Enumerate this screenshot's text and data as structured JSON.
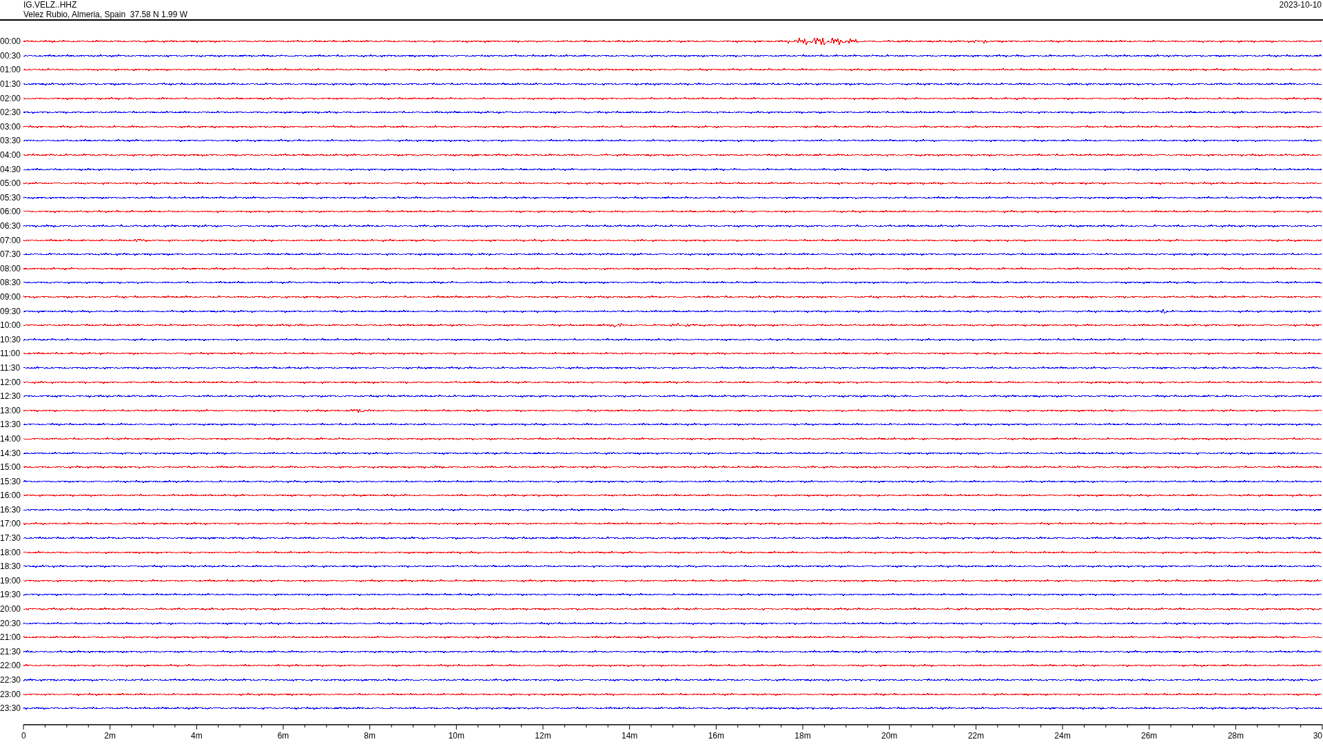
{
  "header": {
    "station": "IG.VELZ..HHZ",
    "location": "Velez Rubio, Almeria, Spain  37.58 N 1.99 W",
    "date": "2023-10-10"
  },
  "rows": [
    {
      "label": "00:00",
      "color": "#ff0000"
    },
    {
      "label": "00:30",
      "color": "#0000ff"
    },
    {
      "label": "01:00",
      "color": "#ff0000"
    },
    {
      "label": "01:30",
      "color": "#0000ff"
    },
    {
      "label": "02:00",
      "color": "#ff0000"
    },
    {
      "label": "02:30",
      "color": "#0000ff"
    },
    {
      "label": "03:00",
      "color": "#ff0000"
    },
    {
      "label": "03:30",
      "color": "#0000ff"
    },
    {
      "label": "04:00",
      "color": "#ff0000"
    },
    {
      "label": "04:30",
      "color": "#0000ff"
    },
    {
      "label": "05:00",
      "color": "#ff0000"
    },
    {
      "label": "05:30",
      "color": "#0000ff"
    },
    {
      "label": "06:00",
      "color": "#ff0000"
    },
    {
      "label": "06:30",
      "color": "#0000ff"
    },
    {
      "label": "07:00",
      "color": "#ff0000"
    },
    {
      "label": "07:30",
      "color": "#0000ff"
    },
    {
      "label": "08:00",
      "color": "#ff0000"
    },
    {
      "label": "08:30",
      "color": "#0000ff"
    },
    {
      "label": "09:00",
      "color": "#ff0000"
    },
    {
      "label": "09:30",
      "color": "#0000ff"
    },
    {
      "label": "10:00",
      "color": "#ff0000"
    },
    {
      "label": "10:30",
      "color": "#0000ff"
    },
    {
      "label": "11:00",
      "color": "#ff0000"
    },
    {
      "label": "11:30",
      "color": "#0000ff"
    },
    {
      "label": "12:00",
      "color": "#ff0000"
    },
    {
      "label": "12:30",
      "color": "#0000ff"
    },
    {
      "label": "13:00",
      "color": "#ff0000"
    },
    {
      "label": "13:30",
      "color": "#0000ff"
    },
    {
      "label": "14:00",
      "color": "#ff0000"
    },
    {
      "label": "14:30",
      "color": "#0000ff"
    },
    {
      "label": "15:00",
      "color": "#ff0000"
    },
    {
      "label": "15:30",
      "color": "#0000ff"
    },
    {
      "label": "16:00",
      "color": "#ff0000"
    },
    {
      "label": "16:30",
      "color": "#0000ff"
    },
    {
      "label": "17:00",
      "color": "#ff0000"
    },
    {
      "label": "17:30",
      "color": "#0000ff"
    },
    {
      "label": "18:00",
      "color": "#ff0000"
    },
    {
      "label": "18:30",
      "color": "#0000ff"
    },
    {
      "label": "19:00",
      "color": "#ff0000"
    },
    {
      "label": "19:30",
      "color": "#0000ff"
    },
    {
      "label": "20:00",
      "color": "#ff0000"
    },
    {
      "label": "20:30",
      "color": "#0000ff"
    },
    {
      "label": "21:00",
      "color": "#ff0000"
    },
    {
      "label": "21:30",
      "color": "#0000ff"
    },
    {
      "label": "22:00",
      "color": "#ff0000"
    },
    {
      "label": "22:30",
      "color": "#0000ff"
    },
    {
      "label": "23:00",
      "color": "#ff0000"
    },
    {
      "label": "23:30",
      "color": "#0000ff"
    }
  ],
  "time_axis": {
    "labels": [
      "0",
      "2m",
      "4m",
      "6m",
      "8m",
      "10m",
      "12m",
      "14m",
      "16m",
      "18m",
      "20m",
      "22m",
      "24m",
      "26m",
      "28m",
      "30"
    ]
  }
}
